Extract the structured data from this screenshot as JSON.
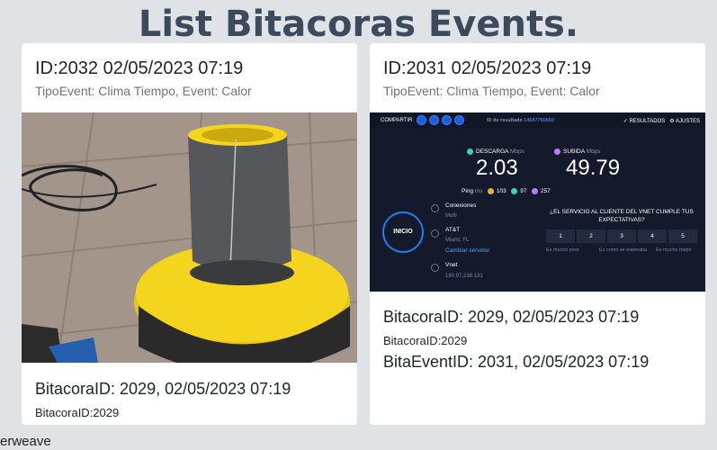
{
  "page": {
    "title": "List Bitacoras Events."
  },
  "cards": [
    {
      "id_line": "ID:2032 02/05/2023 07:19",
      "sub_line": "TipoEvent: Clima Tiempo, Event: Calor",
      "bitacora_title": "BitacoraID: 2029, 02/05/2023 07:19",
      "bitacora_small": "BitacoraID:2029"
    },
    {
      "id_line": "ID:2031 02/05/2023 07:19",
      "sub_line": "TipoEvent: Clima Tiempo, Event: Calor",
      "bitacora_title": "BitacoraID: 2029, 02/05/2023 07:19",
      "bitacora_small": "BitacoraID:2029",
      "bitaevent": "BitaEventID: 2031, 02/05/2023 07:19"
    }
  ],
  "speedtest": {
    "share": "COMPARTIR",
    "result_label": "ID de resultado",
    "result_id": "14687760659",
    "results": "RESULTADOS",
    "settings": "AJUSTES",
    "download_label": "DESCARGA",
    "upload_label": "SUBIDA",
    "unit": "Mbps",
    "download": "2.03",
    "upload": "49.79",
    "ping_label": "Ping",
    "ping_unit": "ms",
    "ping": "103",
    "ping_down": "97",
    "ping_up": "257",
    "connections": "Conexiones",
    "multi": "Multi",
    "go": "INICIO",
    "provider": "AT&T",
    "location": "Miami, FL",
    "change_server": "Cambiar servidor",
    "vnet": "Vnet",
    "ip": "190.97.238.131",
    "question": "¿EL SERVICIO AL CLIENTE DEL VNET CUMPLE TUS EXPECTATIVAS?",
    "scale": [
      "1",
      "2",
      "3",
      "4",
      "5"
    ],
    "scale_low": "Es mucho peor",
    "scale_mid": "Es como se esperaba",
    "scale_high": "Es mucho mejor"
  },
  "footer": {
    "text": "erweave"
  },
  "colors": {
    "yellow": "#f4d41c",
    "accent": "#1d7df2",
    "download": "#3ed2b4",
    "upload": "#b87cff"
  }
}
